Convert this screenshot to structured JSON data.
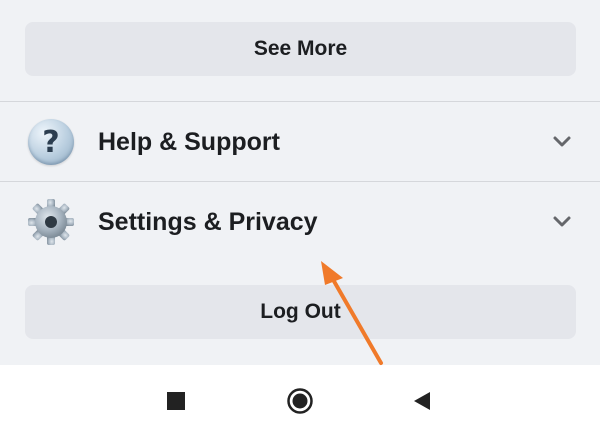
{
  "menu": {
    "see_more_label": "See More",
    "items": [
      {
        "label": "Help & Support",
        "icon": "help-icon"
      },
      {
        "label": "Settings & Privacy",
        "icon": "gear-icon"
      }
    ],
    "logout_label": "Log Out"
  },
  "navigation": {
    "buttons": [
      "recent-apps-icon",
      "home-icon",
      "back-icon"
    ]
  },
  "colors": {
    "background": "#f0f2f5",
    "button_fill": "#e4e6eb",
    "text": "#1c1e21",
    "annotation_arrow": "#f07a2a"
  }
}
